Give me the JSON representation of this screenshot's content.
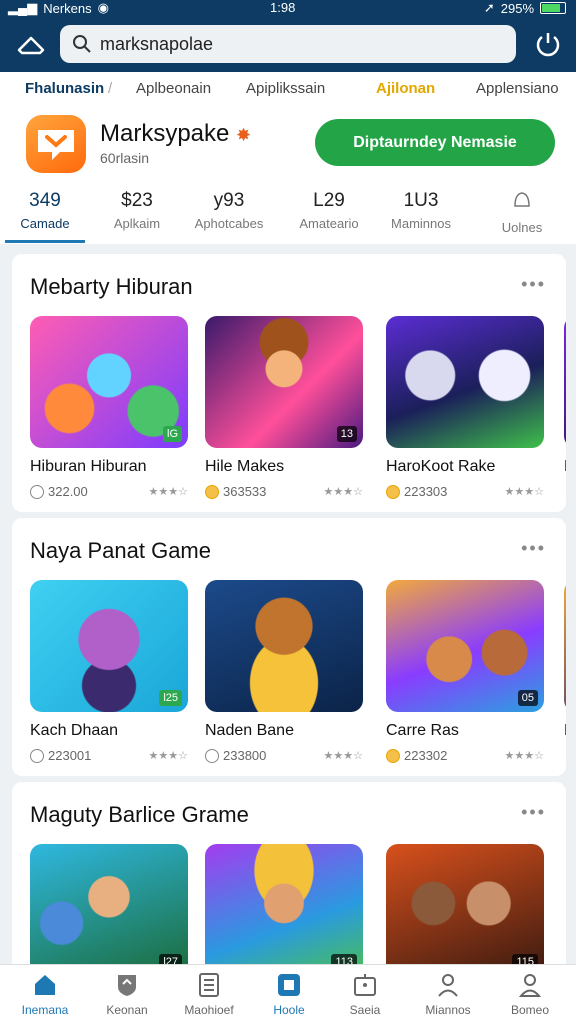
{
  "status_bar": {
    "carrier": "Nerkens",
    "time": "1:98",
    "battery": "295%"
  },
  "search": {
    "value": "marksnapolae"
  },
  "categories": [
    "Fhalunasin",
    "Aplbeonain",
    "Apiplikssain",
    "Ajilonan",
    "Applensiano"
  ],
  "app": {
    "name": "Marksypake",
    "subtitle": "60rlasin",
    "install_label": "Diptaurndey Nemasie"
  },
  "stats": [
    {
      "value": "349",
      "label": "Camade"
    },
    {
      "value": "$23",
      "label": "Aplkaim"
    },
    {
      "value": "y93",
      "label": "Aphotcabes"
    },
    {
      "value": "L29",
      "label": "Amateario"
    },
    {
      "value": "1U3",
      "label": "Maminnos"
    },
    {
      "value": "",
      "label": "Uolnes"
    }
  ],
  "sections": [
    {
      "title": "Mebarty Hiburan",
      "more": "•••",
      "tiles": [
        {
          "name": "Hiburan Hiburan",
          "count": "322.00",
          "stars": "★★★☆",
          "badge": "lG",
          "badge_color": "green",
          "gold": false
        },
        {
          "name": "Hile Makes",
          "count": "363533",
          "stars": "★★★☆",
          "badge": "13",
          "badge_color": "dark",
          "gold": true
        },
        {
          "name": "HaroKoot Rake",
          "count": "223303",
          "stars": "★★★☆",
          "badge": "",
          "badge_color": "dark",
          "gold": true
        },
        {
          "name": "Ra",
          "count": "",
          "stars": "",
          "badge": "",
          "badge_color": "dark",
          "gold": false
        }
      ]
    },
    {
      "title": "Naya Panat Game",
      "more": "•••",
      "tiles": [
        {
          "name": "Kach Dhaan",
          "count": "223001",
          "stars": "★★★☆",
          "badge": "l25",
          "badge_color": "green",
          "gold": false
        },
        {
          "name": "Naden Bane",
          "count": "233800",
          "stars": "★★★☆",
          "badge": "",
          "badge_color": "dark",
          "gold": false
        },
        {
          "name": "Carre Ras",
          "count": "223302",
          "stars": "★★★☆",
          "badge": "05",
          "badge_color": "dark",
          "gold": true
        },
        {
          "name": "Ni",
          "count": "",
          "stars": "",
          "badge": "",
          "badge_color": "dark",
          "gold": false
        }
      ]
    },
    {
      "title": "Maguty Barlice Grame",
      "more": "•••",
      "tiles": [
        {
          "name": "",
          "count": "",
          "stars": "",
          "badge": "l27",
          "badge_color": "dark",
          "gold": false
        },
        {
          "name": "",
          "count": "",
          "stars": "",
          "badge": "113",
          "badge_color": "dark",
          "gold": false
        },
        {
          "name": "",
          "count": "",
          "stars": "",
          "badge": "115",
          "badge_color": "dark",
          "gold": false
        }
      ]
    }
  ],
  "bottom_nav": [
    {
      "label": "Inemana",
      "icon": "home-icon",
      "active": true
    },
    {
      "label": "Keonan",
      "icon": "shield-icon",
      "active": false
    },
    {
      "label": "Maohioef",
      "icon": "document-icon",
      "active": false
    },
    {
      "label": "Hoole",
      "icon": "square-icon",
      "active": true
    },
    {
      "label": "Saeia",
      "icon": "briefcase-icon",
      "active": false
    },
    {
      "label": "Miannos",
      "icon": "person-icon",
      "active": false
    },
    {
      "label": "Bomeo",
      "icon": "profile-icon",
      "active": false
    }
  ],
  "colors": {
    "header": "#0d3b63",
    "accent": "#1d78b4",
    "install": "#22a447"
  }
}
